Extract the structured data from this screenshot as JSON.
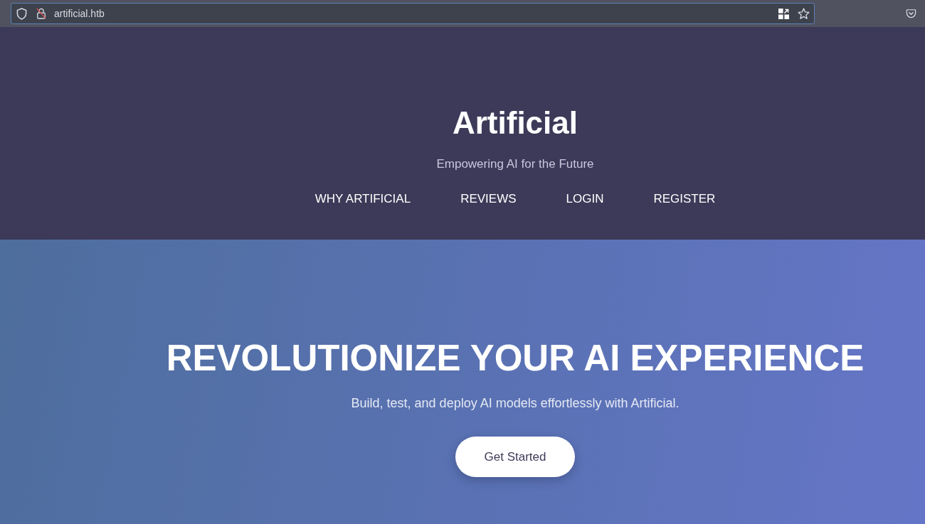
{
  "browser": {
    "url": "artificial.htb"
  },
  "header": {
    "title": "Artificial",
    "tagline": "Empowering AI for the Future",
    "nav": [
      {
        "label": "WHY ARTIFICIAL"
      },
      {
        "label": "REVIEWS"
      },
      {
        "label": "LOGIN"
      },
      {
        "label": "REGISTER"
      }
    ]
  },
  "hero": {
    "heading": "REVOLUTIONIZE YOUR AI EXPERIENCE",
    "text": "Build, test, and deploy AI models effortlessly with Artificial.",
    "button": "Get Started"
  }
}
